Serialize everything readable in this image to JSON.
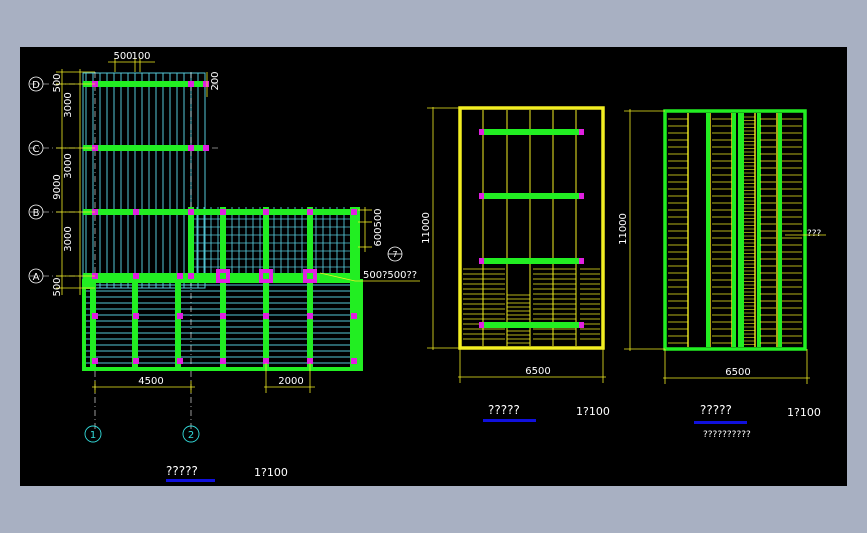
{
  "plan_left": {
    "top_dims": [
      "500",
      "100"
    ],
    "right_dims": [
      "200",
      "500",
      "600"
    ],
    "left_dims": [
      "500",
      "3000",
      "3000",
      "9000",
      "3000",
      "500"
    ],
    "bottom_dims": [
      "4500",
      "2000"
    ],
    "axis_rows": [
      "D",
      "C",
      "B",
      "A"
    ],
    "axis_cols": [
      "1",
      "2"
    ],
    "callout_num": "7",
    "callout_text": "500?500??",
    "title": "?????",
    "scale": "1?100"
  },
  "plan_mid": {
    "height_dim": "11000",
    "width_dim": "6500",
    "title": "?????",
    "scale": "1?100"
  },
  "plan_right": {
    "height_dim": "11000",
    "width_dim": "6500",
    "side_label": "???",
    "title": "?????",
    "subtitle": "??????????",
    "scale": "1?100"
  },
  "colors": {
    "beam": "#22ee22",
    "joist": "#55c8d8",
    "node": "#e020e0",
    "frame_yellow": "#f2ee22",
    "dim": "#f2ee22",
    "text": "#ffffff",
    "axis_circle": "#33dddd",
    "underline": "#1010dd"
  }
}
